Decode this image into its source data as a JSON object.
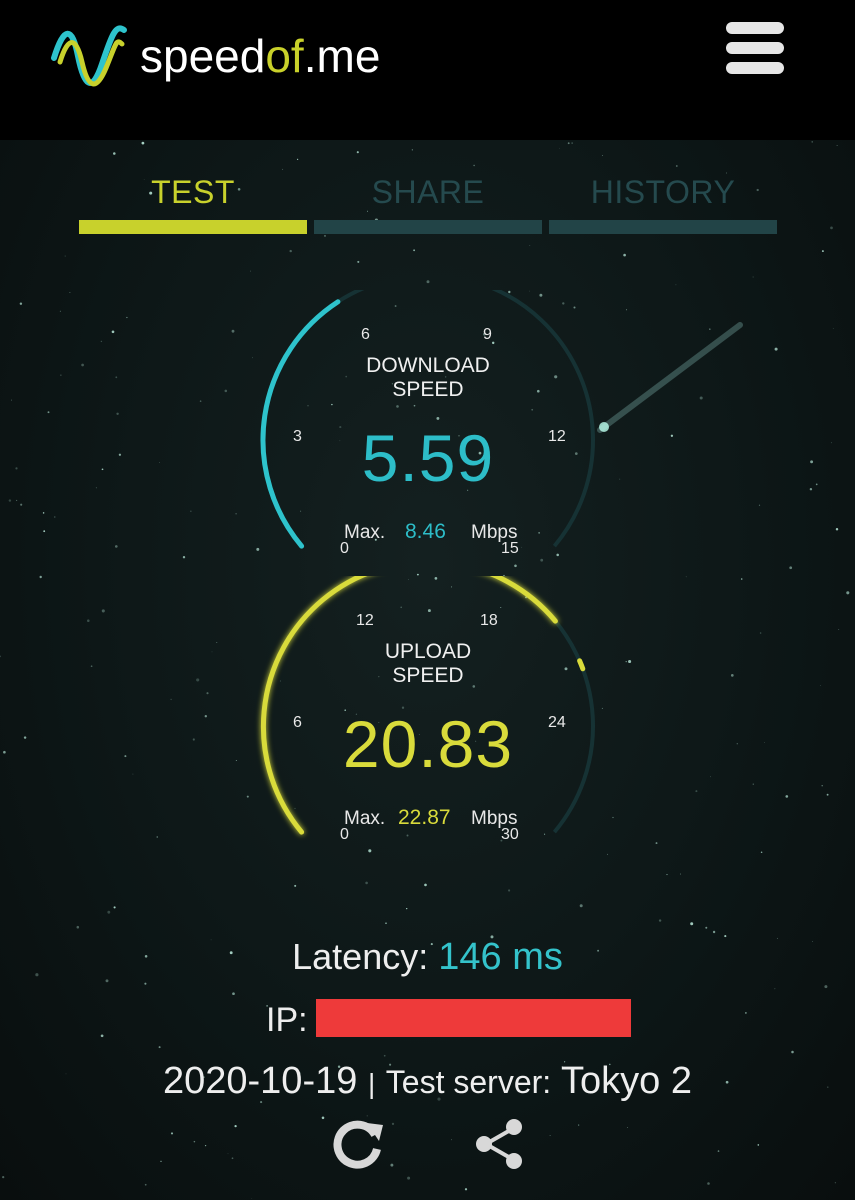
{
  "app": {
    "logo_main": "speed",
    "logo_of": "of",
    "logo_tail": ".me"
  },
  "icons": {
    "logo": "wave-logo-icon",
    "menu": "hamburger-menu-icon",
    "refresh": "refresh-icon",
    "share": "share-icon"
  },
  "colors": {
    "accent_cyan": "#2dbdc8",
    "accent_yellow": "#c8d12c",
    "tab_inactive": "#224447",
    "redaction": "#ee3a3a"
  },
  "tabs": [
    {
      "label": "TEST",
      "active": true
    },
    {
      "label": "SHARE",
      "active": false
    },
    {
      "label": "HISTORY",
      "active": false
    }
  ],
  "download": {
    "title_line1": "DOWNLOAD",
    "title_line2": "SPEED",
    "value": "5.59",
    "max_label": "Max.",
    "max_value": "8.46",
    "unit": "Mbps",
    "scale_max": 15,
    "ticks": [
      "0",
      "3",
      "6",
      "9",
      "12",
      "15"
    ]
  },
  "upload": {
    "title_line1": "UPLOAD",
    "title_line2": "SPEED",
    "value": "20.83",
    "max_label": "Max.",
    "max_value": "22.87",
    "unit": "Mbps",
    "scale_max": 30,
    "ticks": [
      "0",
      "6",
      "12",
      "18",
      "24",
      "30"
    ]
  },
  "latency": {
    "label": "Latency:",
    "value": "146 ms"
  },
  "ip": {
    "label": "IP:"
  },
  "footer": {
    "date": "2020-10-19",
    "separator": "|",
    "server_label": "Test server:",
    "server_name": "Tokyo 2"
  }
}
